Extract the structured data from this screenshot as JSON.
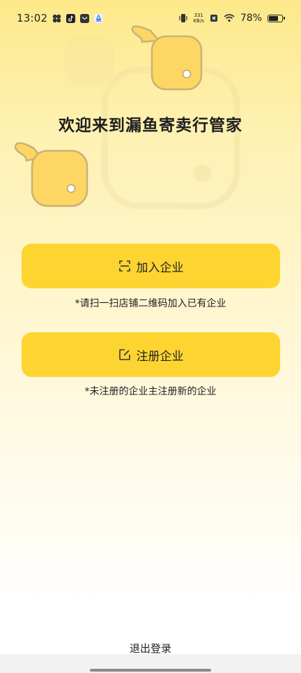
{
  "status_bar": {
    "time": "13:02",
    "notification_icons": [
      "pinwheel-icon",
      "tiktok-icon",
      "mail-icon",
      "app-icon"
    ],
    "network_speed_value": "331",
    "network_speed_unit": "KB/s",
    "battery_percent": "78%",
    "battery_level": 0.78
  },
  "welcome_title": "欢迎来到漏鱼寄卖行管家",
  "join_button": {
    "label": "加入企业",
    "icon": "scan-icon"
  },
  "join_hint": "*请扫一扫店铺二维码加入已有企业",
  "register_button": {
    "label": "注册企业",
    "icon": "edit-icon"
  },
  "register_hint": "*未注册的企业主注册新的企业",
  "logout_label": "退出登录",
  "colors": {
    "accent": "#fed530",
    "background_top": "#fde98a",
    "mascot": "#fdd664",
    "text": "#222222"
  }
}
